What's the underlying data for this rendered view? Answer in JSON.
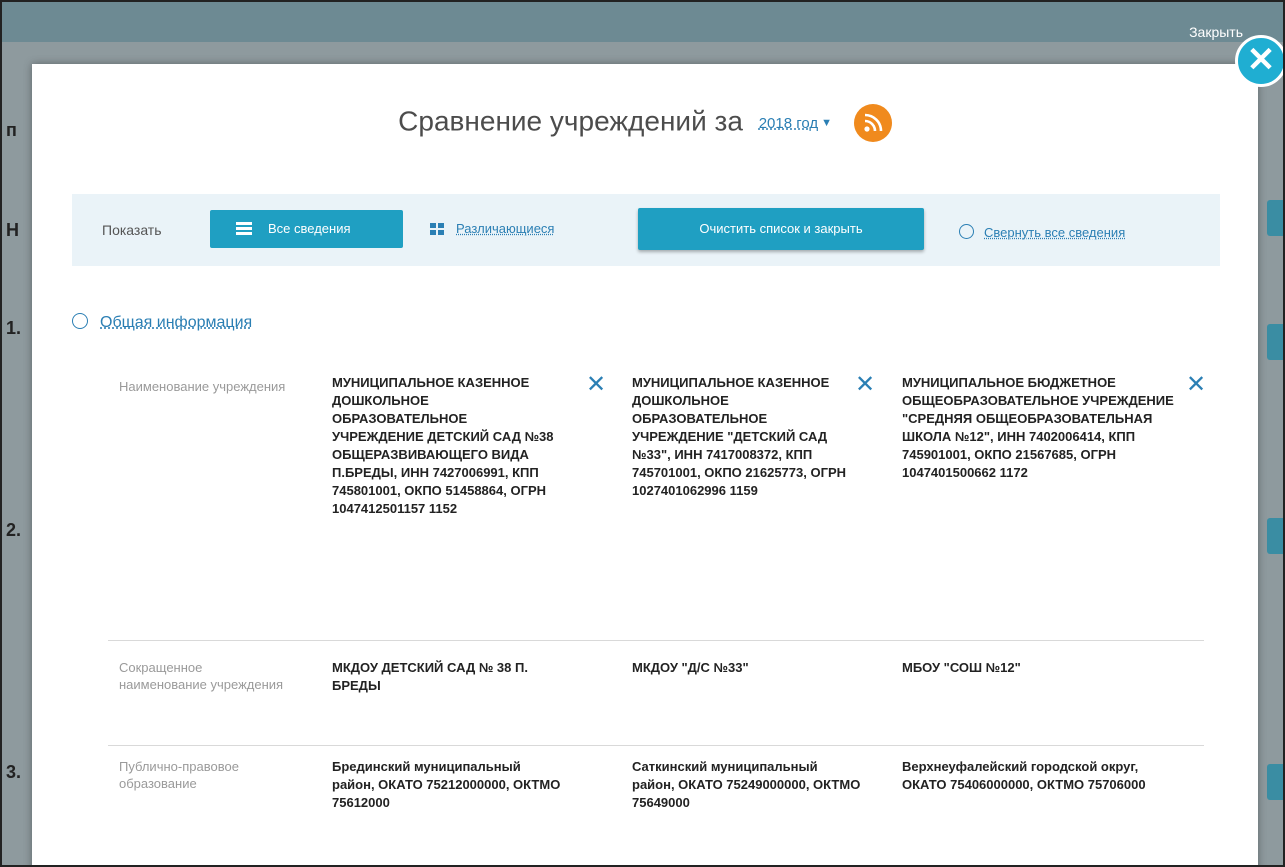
{
  "background": {
    "close_label": "Закрыть",
    "left_markers": [
      "п",
      "Н",
      "1.",
      "2.",
      "3."
    ]
  },
  "modal": {
    "title": "Сравнение учреждений за",
    "year": "2018 год",
    "rss_icon": "rss-icon",
    "close_icon": "close-icon"
  },
  "toolbar": {
    "show_label": "Показать",
    "all_info": "Все сведения",
    "differing": "Различающиеся",
    "clear": "Очистить список и закрыть",
    "collapse": "Свернуть все сведения"
  },
  "section": {
    "title": "Общая информация"
  },
  "rows": [
    {
      "label": "Наименование учреждения",
      "values": [
        "МУНИЦИПАЛЬНОЕ КАЗЕННОЕ ДОШКОЛЬНОЕ ОБРАЗОВАТЕЛЬНОЕ УЧРЕЖДЕНИЕ ДЕТСКИЙ САД №38 ОБЩЕРАЗВИВАЮЩЕГО ВИДА П.БРЕДЫ, ИНН 7427006991, КПП 745801001, ОКПО 51458864, ОГРН 1047412501157 1152",
        "МУНИЦИПАЛЬНОЕ КАЗЕННОЕ ДОШКОЛЬНОЕ ОБРАЗОВАТЕЛЬНОЕ УЧРЕЖДЕНИЕ \"ДЕТСКИЙ САД №33\", ИНН 7417008372, КПП 745701001, ОКПО 21625773, ОГРН 1027401062996 1159",
        "МУНИЦИПАЛЬНОЕ БЮДЖЕТНОЕ ОБЩЕОБРАЗОВАТЕЛЬНОЕ УЧРЕЖДЕНИЕ \"СРЕДНЯЯ ОБЩЕОБРАЗОВАТЕЛЬНАЯ ШКОЛА №12\", ИНН 7402006414, КПП 745901001, ОКПО 21567685, ОГРН 1047401500662 1172"
      ]
    },
    {
      "label": "Сокращенное наименование учреждения",
      "values": [
        "МКДОУ ДЕТСКИЙ САД № 38 П. БРЕДЫ",
        "МКДОУ \"Д/С №33\"",
        "МБОУ \"СОШ №12\""
      ]
    },
    {
      "label": "Публично-правовое образование",
      "values": [
        "Брединский муниципальный район, ОКАТО 75212000000, ОКТМО 75612000",
        "Саткинский муниципальный район, ОКАТО 75249000000, ОКТМО 75649000",
        "Верхнеуфалейский городской округ, ОКАТО 75406000000, ОКТМО 75706000"
      ]
    }
  ]
}
